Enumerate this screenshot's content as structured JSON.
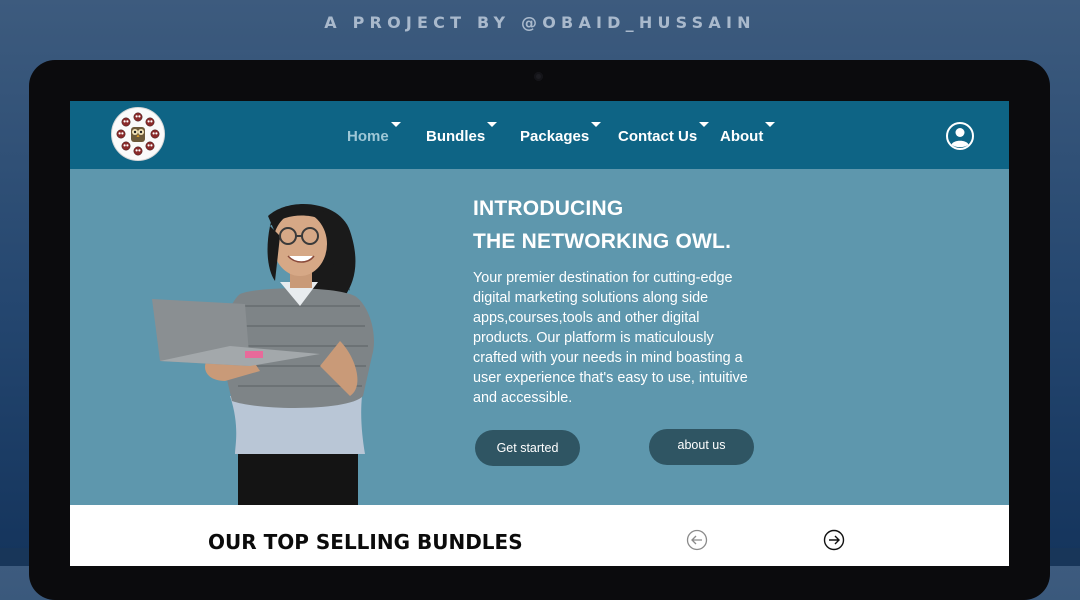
{
  "credit": "A PROJECT BY @OBAID_HUSSAIN",
  "nav": {
    "items": [
      {
        "label": "Home",
        "active": true
      },
      {
        "label": "Bundles",
        "active": false
      },
      {
        "label": "Packages",
        "active": false
      },
      {
        "label": "Contact Us",
        "active": false
      },
      {
        "label": "About",
        "active": false
      }
    ],
    "logo_icon": "owl-logo-icon",
    "user_icon": "user-account-icon"
  },
  "hero": {
    "title_line1": "INTRODUCING",
    "title_line2": "THE NETWORKING OWL.",
    "description": "Your premier destination for cutting-edge digital marketing solutions along side apps,courses,tools and other digital products. Our platform is maticulously crafted with your needs in mind boasting a user experience that's easy to use, intuitive and accessible.",
    "get_started_label": "Get started",
    "about_us_label": "about us",
    "image": "woman-with-laptop-photo"
  },
  "bundles": {
    "title": "OUR TOP SELLING BUNDLES",
    "prev_icon": "arrow-left-circle-icon",
    "next_icon": "arrow-right-circle-icon"
  },
  "colors": {
    "nav_bg": "#0e6485",
    "hero_bg": "#5e97ad",
    "button_bg": "#2f5563",
    "active_nav": "#9ec7d6",
    "page_bg": "#24466f"
  }
}
